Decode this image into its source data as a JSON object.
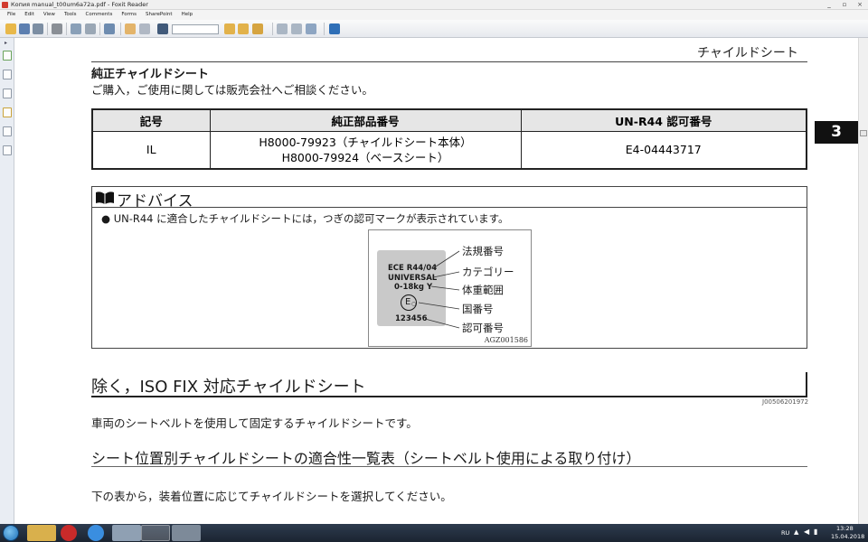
{
  "window": {
    "title": "Копия manual_t00um6a72a.pdf - Foxit Reader"
  },
  "menu": {
    "items": [
      "File",
      "Edit",
      "View",
      "Tools",
      "Comments",
      "Forms",
      "SharePoint",
      "Help"
    ],
    "right_controls": [
      "_",
      "▫",
      "×"
    ]
  },
  "toolbar": {
    "search_value": ""
  },
  "page": {
    "header_title": "チャイルドシート",
    "section_title": "純正チャイルドシート",
    "section_desc": "ご購入，ご使用に関しては販売会社へご相談ください。",
    "table": {
      "headers": [
        "記号",
        "純正部品番号",
        "UN-R44 認可番号"
      ],
      "row": {
        "code": "IL",
        "part_line1": "H8000-79923（チャイルドシート本体）",
        "part_line2": "H8000-79924（ベースシート）",
        "approval": "E4-04443717"
      }
    },
    "advice": {
      "title": "アドバイス",
      "bullet": "● UN-R44 に適合したチャイルドシートには，つぎの認可マークが表示されています。",
      "figure": {
        "plate_lines": [
          "ECE R44/04",
          "UNIVERSAL",
          "0-18kg Y",
          "123456"
        ],
        "plate_mark": "E",
        "plate_mark_sub": "○",
        "labels": [
          "法規番号",
          "カテゴリー",
          "体重範囲",
          "国番号",
          "認可番号"
        ],
        "figure_id": "AGZ001586"
      }
    },
    "heading2": "除く，ISO FIX 対応チャイルドシート",
    "heading2_code": "J00506201972",
    "para1": "車両のシートベルトを使用して固定するチャイルドシートです。",
    "heading3": "シート位置別チャイルドシートの適合性一覧表（シートベルト使用による取り付け）",
    "para2": "下の表から，装着位置に応じてチャイルドシートを選択してください。",
    "chapter_tab": "3"
  },
  "taskbar": {
    "language": "RU",
    "time": "13:28",
    "date": "15.04.2018"
  },
  "colors": {
    "toolbar_bg": "#e6e9ee",
    "taskbar_bg": "#1b2431",
    "table_header_bg": "#e6e6e6",
    "plate_gray": "#c9c9c9",
    "chapter_tab_bg": "#111111"
  },
  "icons": [
    "open-folder-icon",
    "save-icon",
    "print-icon",
    "email-icon",
    "hand-tool-icon",
    "zoom-icon",
    "find-icon",
    "highlight-icon",
    "comment-icon",
    "fit-page-icon",
    "rotate-icon",
    "foxit-logo-icon",
    "bookmarks-panel-icon",
    "pages-panel-icon",
    "layers-panel-icon",
    "comments-panel-icon",
    "attachments-panel-icon",
    "signature-panel-icon"
  ]
}
